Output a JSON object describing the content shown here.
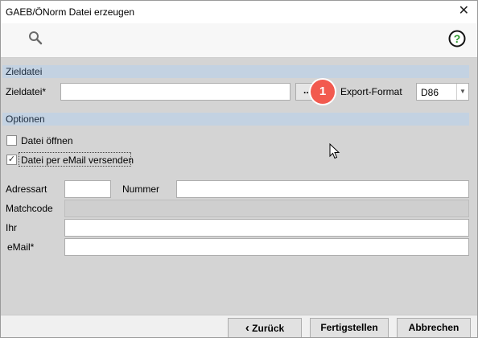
{
  "window": {
    "title": "GAEB/ÖNorm Datei erzeugen",
    "close_glyph": "✕"
  },
  "toolbar": {
    "search_icon": "search-icon",
    "help_icon": "help-icon",
    "help_glyph": "?"
  },
  "sections": {
    "zieldatei": "Zieldatei",
    "optionen": "Optionen"
  },
  "zieldatei": {
    "label": "Zieldatei*",
    "value": "",
    "browse_label": "...",
    "export_label": "Export-Format",
    "export_value": "D86",
    "dropdown_glyph": "▼"
  },
  "badge": {
    "value": "1",
    "color": "#f25a4f"
  },
  "options": {
    "open_file": {
      "label": "Datei öffnen",
      "checked": false,
      "glyph": ""
    },
    "send_email": {
      "label": "Datei per eMail versenden",
      "checked": true,
      "glyph": "✓"
    }
  },
  "email_form": {
    "adressart_label": "Adressart",
    "adressart_value": "",
    "nummer_label": "Nummer",
    "nummer_value": "",
    "matchcode_label": "Matchcode",
    "matchcode_value": "",
    "ihr_label": "Ihr",
    "ihr_value": "",
    "email_label": "eMail*",
    "email_value": ""
  },
  "footer": {
    "back_arrow": "‹",
    "back_label": "Zurück",
    "finish_label": "Fertigstellen",
    "cancel_label": "Abbrechen"
  }
}
